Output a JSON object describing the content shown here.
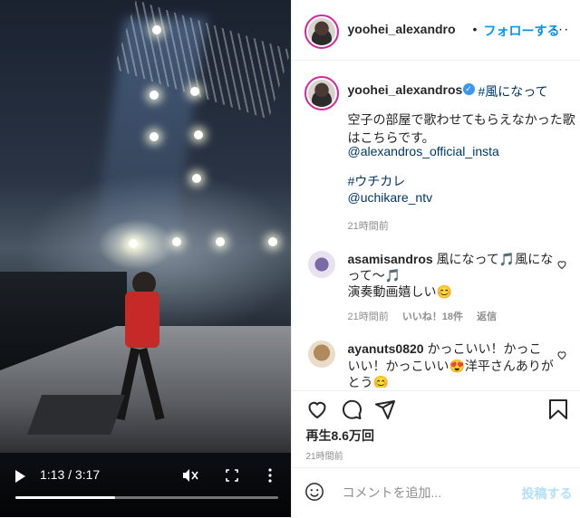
{
  "header": {
    "username": "yoohei_alexandro",
    "separator": "•",
    "follow_label": "フォローする",
    "more_label": "···"
  },
  "caption": {
    "username": "yoohei_alexandros",
    "verified_mark": "✓",
    "hashtag": "#風になって",
    "line1": "空子の部屋で歌わせてもらえなかった歌",
    "line2": "はこちらです。",
    "mention1": "@alexandros_official_insta",
    "hashtag2": "#ウチカレ",
    "mention2": "@uchikare_ntv",
    "time": "21時間前"
  },
  "comments": [
    {
      "username": "asamisandros",
      "text_part1": "風になって🎵風にな",
      "text_part2": "って〜🎵",
      "text_part3": "演奏動画嬉しい😊",
      "time": "21時間前",
      "likes": "いいね！18件",
      "reply": "返信"
    },
    {
      "username": "ayanuts0820",
      "text_part1": "かっこいい！かっこ",
      "text_part2": "いい！かっこいい😍洋平さんありが",
      "text_part3": "とう😊"
    }
  ],
  "video": {
    "time": "1:13 / 3:17",
    "progress_fraction": 0.38
  },
  "stats": {
    "views": "再生8.6万回",
    "posted": "21時間前"
  },
  "add_comment": {
    "placeholder": "コメントを追加...",
    "post_label": "投稿する"
  },
  "colors": {
    "accent": "#0095f6",
    "link": "#00376b",
    "muted": "#8e8e8e",
    "post_disabled": "#b2dffc",
    "jersey": "#c52a28"
  }
}
